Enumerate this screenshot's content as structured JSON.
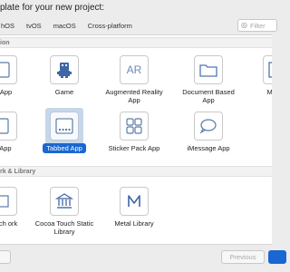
{
  "header": {
    "title": "plate for your new project:"
  },
  "platform_tabs": [
    "hOS",
    "tvOS",
    "macOS",
    "Cross-platform"
  ],
  "filter": {
    "placeholder": "Filter"
  },
  "sections": [
    {
      "title": "ion"
    },
    {
      "title": "rk & Library"
    }
  ],
  "templates": [
    {
      "label": "w App",
      "icon": "single-view-app-icon"
    },
    {
      "label": "Game",
      "icon": "game-icon"
    },
    {
      "label": "Augmented Reality App",
      "icon": "augmented-reality-icon",
      "icon_text": "AR"
    },
    {
      "label": "Document Based App",
      "icon": "folder-icon"
    },
    {
      "label": "Master",
      "icon": "master-detail-icon"
    },
    {
      "label": "d App",
      "icon": "page-based-app-icon"
    },
    {
      "label": "Tabbed App",
      "icon": "tabbed-app-icon",
      "selected": true
    },
    {
      "label": "Sticker Pack App",
      "icon": "sticker-pack-icon"
    },
    {
      "label": "iMessage App",
      "icon": "imessage-app-icon"
    },
    {
      "label": "Touch ork",
      "icon": "cocoa-touch-framework-icon"
    },
    {
      "label": "Cocoa Touch Static Library",
      "icon": "static-library-icon"
    },
    {
      "label": "Metal Library",
      "icon": "metal-library-icon"
    }
  ],
  "footer": {
    "cancel_label": "",
    "previous_label": "Previous",
    "next_label": ""
  },
  "colors": {
    "accent": "#1a66d2",
    "selection_bg": "#c7d7ea"
  }
}
